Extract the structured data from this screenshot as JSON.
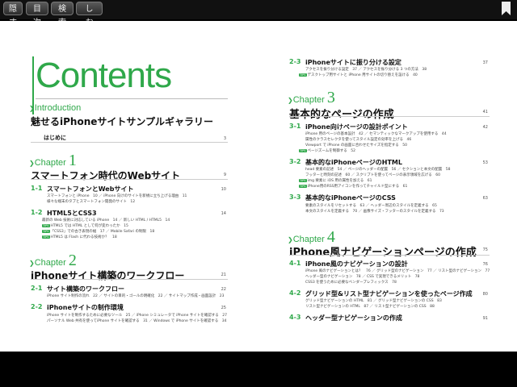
{
  "toolbar": {
    "buttons": [
      "隠す",
      "目次",
      "検索",
      "しおり"
    ]
  },
  "contents": {
    "title": "Contents",
    "intro": {
      "label": "Introduction",
      "title": "魅せるiPhoneサイトサンプルギャラリー",
      "hajime": "はじめに",
      "hajime_page": "3"
    },
    "ch1": {
      "label": "Chapter",
      "num": "1",
      "title": "スマートフォン時代のWebサイト",
      "page": "9",
      "s1": {
        "num": "1-1",
        "title": "スマートフォンとWebサイト",
        "page": "10",
        "subs": [
          "スマートフォンと iPhone　10 ／ iPhone 向けのサイトを新規に立ち上げる理由　11",
          "様々な端末のタブとスマートフォン開発のサイト　12"
        ]
      },
      "s2": {
        "num": "1-2",
        "title": "HTML5とCSS3",
        "page": "14",
        "subs": [
          "最新の Web 技術に対応している iPhone　14 ／ 新しい HTML / HTML5　14",
          "HTML5 では HTML として何が変わったか　15",
          "「CSS3」での古き表現の幅　17 ／ Mobile Safari の制限　18",
          "HTML5 は Flash に代わる技術か？　18"
        ]
      }
    },
    "ch2": {
      "label": "Chapter",
      "num": "2",
      "title": "iPhoneサイト構築のワークフロー",
      "page": "21",
      "s1": {
        "num": "2-1",
        "title": "サイト構築のワークフロー",
        "page": "22",
        "subs": [
          "iPhone サイト制作の流れ　22 ／ サイトの目的・ゴールの明確化　22 ／ サイトマップ作成・画面設計　23"
        ]
      },
      "s2": {
        "num": "2-2",
        "title": "iPhoneサイトの制作環境",
        "page": "25",
        "subs": [
          "iPhone サイトを制作するために必要なツール　25 ／ iPhone シミュレータで iPhone サイトを確認する　27",
          "パーソナル Web 共有を使ってiPhone サイトを確認する　31 ／ Windows で iPhone サイトを確認する　34"
        ]
      }
    },
    "ch2_3": {
      "num": "2-3",
      "title": "iPhoneサイトに振り分ける設定",
      "page": "37",
      "subs": [
        "アクセスを振り分ける設定　37 ／ アクセスを振り分ける 3 つの方法　38",
        "デスクトップ用サイトと iPhone 用サイトの切り替えを設ける　40"
      ]
    },
    "ch3": {
      "label": "Chapter",
      "num": "3",
      "title": "基本的なページの作成",
      "page": "41",
      "s1": {
        "num": "3-1",
        "title": "iPhone向けページの設計ポイント",
        "page": "42",
        "subs": [
          "iPhone 用のページの基本設計　42 ／ セマンティックなマークアップを使用する　44",
          "属性のクラスセレクタを使ってスタイル設定の効率を上げる　46",
          "Viewport で iPhone の画面に合わせたサイズを指定する　50",
          "ページズームを制御する　52"
        ]
      },
      "s2": {
        "num": "3-2",
        "title": "基本的なiPhoneページのHTML",
        "page": "53",
        "subs": [
          "head 要素の記述　54 ／ ページのヘッダーの配置　56 ／ セクションと本文の配置　58",
          "フッターと時刻の記述　60 ／ スクリプトを使ってページの表示領域を広げる　60",
          "img 要素に iOS 用の属性を加える　61",
          "iPhone用のRSS用アイコンを作ってチャイルド型にする　61"
        ]
      },
      "s3": {
        "num": "3-3",
        "title": "基本的なiPhoneページのCSS",
        "page": "63",
        "subs": [
          "要素のスタイルをリセットする　63 ／ ヘッダー周辺のスタイルを定義する　65",
          "本文のスタイルを定義する　70 ／ 画像サイズ・フッターのスタイルを定義する　73"
        ]
      }
    },
    "ch4": {
      "label": "Chapter",
      "num": "4",
      "title": "iPhone風ナビゲーションページの作成",
      "page": "75",
      "s1": {
        "num": "4-1",
        "title": "iPhone風のナビゲーションの設計",
        "page": "76",
        "subs": [
          "iPhone 風のナビゲーションとは？　76 ／ グリッド型のナビゲーション　77 ／ リスト型のナビゲーション　77",
          "ヘッダー型のナビゲーション　78 ／ CSS で実現できるメリット　78",
          "CSS3 を使うために必要なベンダープレフィックス　78"
        ]
      },
      "s2": {
        "num": "4-2",
        "title": "グリッド型&リスト型ナビゲーションを使ったページ作成",
        "page": "80",
        "subs": [
          "グリッド型ナビゲーションの HTML　81 ／ グリッド型ナビゲーションの CSS　83",
          "リスト型ナビゲーションの HTML　87 ／ リスト型ナビゲーションの CSS　88"
        ]
      },
      "s3": {
        "num": "4-3",
        "title": "ヘッダー型ナビゲーションの作成",
        "page": "91"
      }
    }
  }
}
